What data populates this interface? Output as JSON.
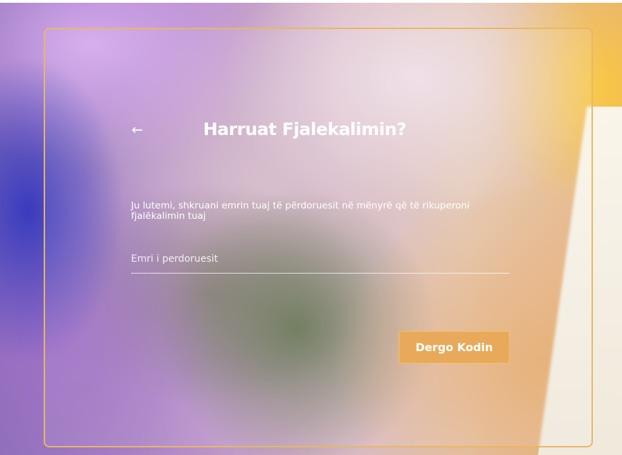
{
  "form": {
    "back_icon": "arrow-left-icon",
    "back_glyph": "←",
    "title": "Harruat Fjalekalimin?",
    "description": "Ju lutemi, shkruani emrin tuaj të përdoruesit në mënyrë që të rikuperoni fjalëkalimin tuaj",
    "username_placeholder": "Emri i perdoruesit",
    "username_value": "",
    "submit_label": "Dergo Kodin"
  },
  "colors": {
    "card_border": "#e9b764",
    "button_bg": "#e8aa5a",
    "text": "#ffffff"
  }
}
